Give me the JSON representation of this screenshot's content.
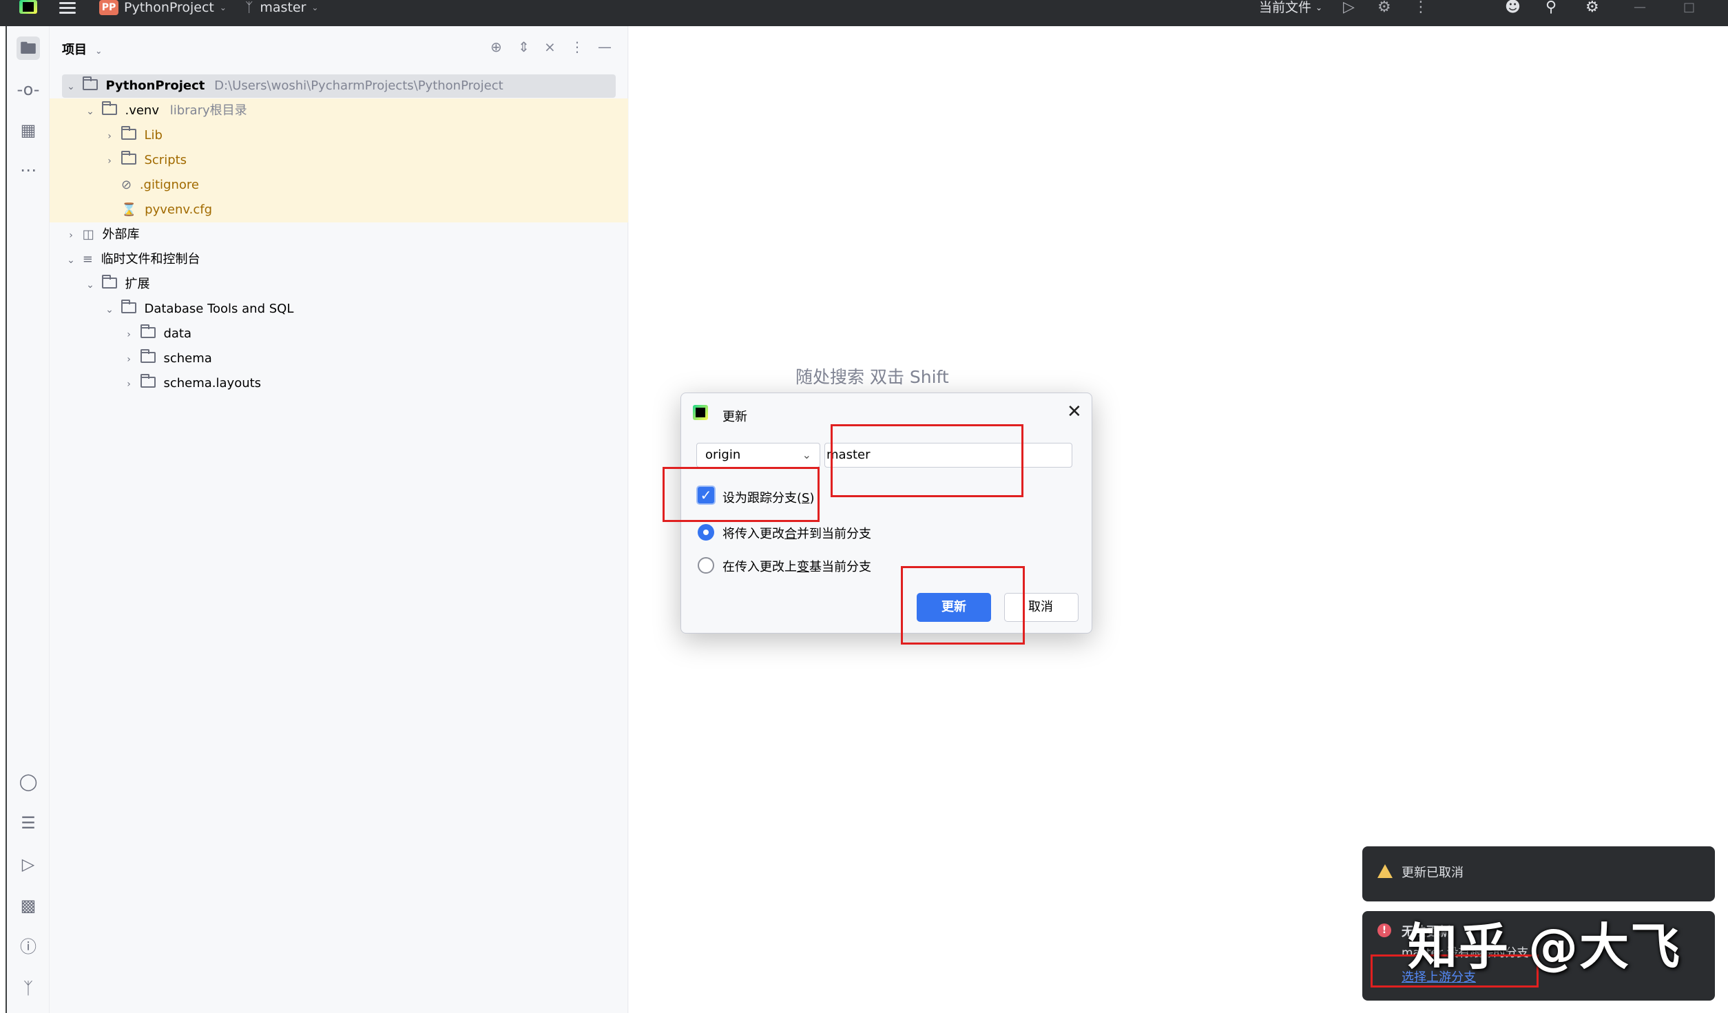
{
  "titlebar": {
    "project_badge": "PP",
    "project_name": "PythonProject",
    "branch": "master",
    "current_file": "当前文件"
  },
  "project_panel": {
    "title": "项目",
    "tree": [
      {
        "label": "PythonProject",
        "path": "D:\\Users\\woshi\\PycharmProjects\\PythonProject"
      },
      {
        "label": ".venv",
        "extra": "library根目录"
      },
      {
        "label": "Lib"
      },
      {
        "label": "Scripts"
      },
      {
        "label": ".gitignore"
      },
      {
        "label": "pyvenv.cfg"
      },
      {
        "label": "外部库"
      },
      {
        "label": "临时文件和控制台"
      },
      {
        "label": "扩展"
      },
      {
        "label": "Database Tools and SQL"
      },
      {
        "label": "data"
      },
      {
        "label": "schema"
      },
      {
        "label": "schema.layouts"
      }
    ]
  },
  "editor": {
    "hint": "随处搜索 双击 Shift"
  },
  "dialog": {
    "title": "更新",
    "remote": "origin",
    "branch_value": "master",
    "checkbox_label_pre": "设为跟踪分支(",
    "checkbox_label_key": "S",
    "checkbox_label_post": ")",
    "radio_merge_pre": "将传入更改",
    "radio_merge_key": "合",
    "radio_merge_post": "并到当前分支",
    "radio_rebase_pre": "在传入更改上",
    "radio_rebase_key": "变",
    "radio_rebase_post": "基当前分支",
    "update_button": "更新",
    "cancel_button": "取消"
  },
  "notifications": {
    "cancelled": "更新已取消",
    "error_title": "无法更新",
    "error_body": "master 没有跟踪的分支",
    "error_link": "选择上游分支"
  },
  "watermark": "知乎 @大飞",
  "colors": {
    "accent": "#3574f0",
    "annotation_red": "#e02020",
    "titlebar_bg": "#2b2d30",
    "venv_highlight": "#fdf5dc"
  }
}
